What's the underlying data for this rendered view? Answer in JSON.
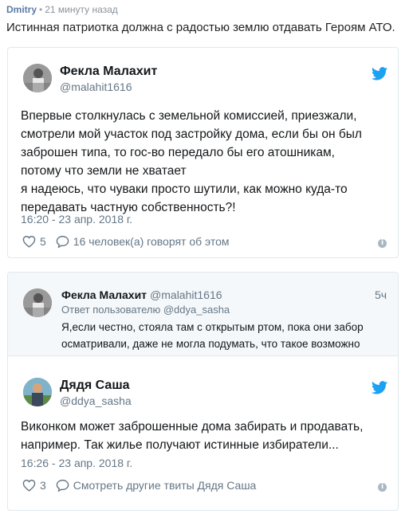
{
  "post": {
    "author": "Dmitry",
    "separator": "•",
    "time": "21 минуту назад",
    "text": "Истинная патриотка должна с радостью землю отдавать Героям АТО."
  },
  "tweet1": {
    "name": "Фекла Малахит",
    "handle": "@malahit1616",
    "lines": [
      "Впервые столкнулась с земельной комиссией, приезжали,",
      "смотрели мой участок под застройку дома, если бы он был",
      "заброшен типа, то гос-во передало бы его атошникам,",
      "потому что земли не хватает",
      "я надеюсь, что чуваки просто шутили, как можно куда-то",
      "передавать частную собственность?!"
    ],
    "date": "16:20 - 23 апр. 2018 г.",
    "likes": "5",
    "people_talking": "16 человек(а) говорят об этом",
    "icons": {
      "like": "heart-icon",
      "reply": "comment-icon",
      "brand": "twitter-bird-icon",
      "info": "info-icon"
    }
  },
  "tweet2": {
    "quoted": {
      "name": "Фекла Малахит",
      "handle": "@malahit1616",
      "time": "5ч",
      "reply_prefix": "Ответ пользователю",
      "reply_to": "@ddya_sasha",
      "lines": [
        "Я,если честно, стояла там с открытым ртом, пока они забор",
        "осматривали, даже не могла подумать, что такое возможно"
      ]
    },
    "name": "Дядя Саша",
    "handle": "@ddya_sasha",
    "lines": [
      "Виконком может заброшенные дома забирать и продавать,",
      "например. Так жилье получают истинные избиратели..."
    ],
    "date": "16:26 - 23 апр. 2018 г.",
    "likes": "3",
    "more_link": "Смотреть другие твиты Дядя Саша"
  },
  "colors": {
    "twitter_blue": "#1da1f2",
    "author_link": "#5b7ba8",
    "muted": "#657786",
    "border": "#e1e8ed"
  }
}
